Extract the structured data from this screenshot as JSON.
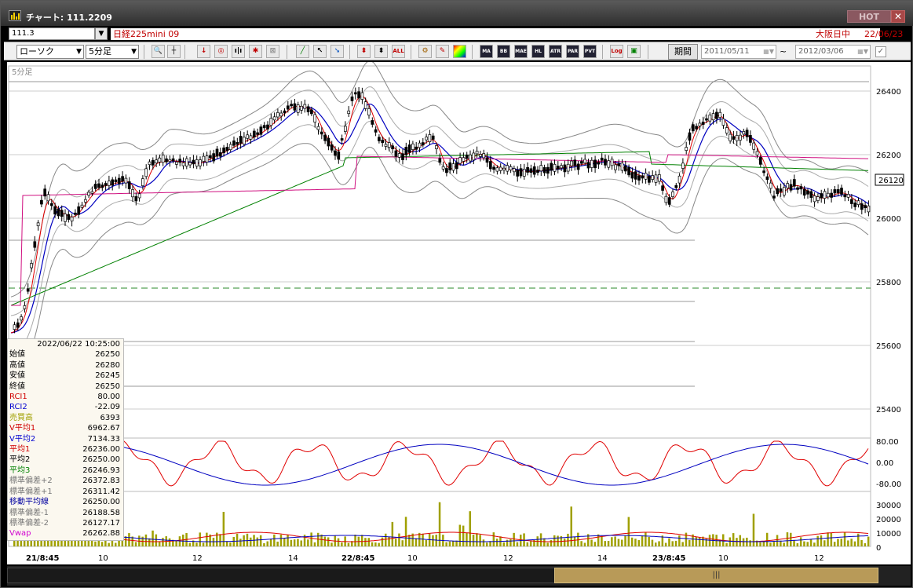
{
  "window": {
    "title": "チャート: 111.2209",
    "hot": "HOT",
    "close": "✕"
  },
  "symbol": {
    "code": "111.3",
    "name": "日経225mini 09",
    "session": "大阪日中",
    "date": "22/06/23"
  },
  "toolbar": {
    "chart_type": "ローソク",
    "interval": "5分足",
    "period_label": "期間",
    "date_from": "2011/05/11",
    "tilde": "~",
    "date_to": "2012/03/06",
    "buttons": [
      "MA",
      "BB",
      "MAE",
      "HL",
      "ATR",
      "PAR",
      "PVT",
      "Log"
    ]
  },
  "chart": {
    "interval_label": "5分足",
    "current_price": "26120",
    "y_ticks": [
      "26400",
      "26200",
      "26000",
      "25800",
      "25600",
      "25400"
    ],
    "osc_ticks": [
      "80.00",
      "0.00",
      "-80.00"
    ],
    "vol_ticks": [
      "30000",
      "20000",
      "10000",
      "0"
    ],
    "x_ticks": [
      "21/8:45",
      "10",
      "12",
      "14",
      "22/8:45",
      "10",
      "12",
      "14",
      "23/8:45",
      "10",
      "12"
    ]
  },
  "info": {
    "datetime": "2022/06/22  10:25:00",
    "rows": [
      {
        "label": "始値",
        "value": "26250",
        "color": "#000000"
      },
      {
        "label": "高値",
        "value": "26280",
        "color": "#000000"
      },
      {
        "label": "安値",
        "value": "26245",
        "color": "#000000"
      },
      {
        "label": "終値",
        "value": "26250",
        "color": "#000000"
      },
      {
        "label": "RCI1",
        "value": "80.00",
        "color": "#d00000"
      },
      {
        "label": "RCI2",
        "value": "-22.09",
        "color": "#0000d0"
      },
      {
        "label": "売買高",
        "value": "6393",
        "color": "#a0a000"
      },
      {
        "label": "V平均1",
        "value": "6962.67",
        "color": "#d00000"
      },
      {
        "label": "V平均2",
        "value": "7134.33",
        "color": "#0000d0"
      },
      {
        "label": "平均1",
        "value": "26236.00",
        "color": "#d00000"
      },
      {
        "label": "平均2",
        "value": "26250.00",
        "color": "#000000"
      },
      {
        "label": "平均3",
        "value": "26246.93",
        "color": "#008000"
      },
      {
        "label": "標準偏差+2",
        "value": "26372.83",
        "color": "#777777"
      },
      {
        "label": "標準偏差+1",
        "value": "26311.42",
        "color": "#777777"
      },
      {
        "label": "移動平均線",
        "value": "26250.00",
        "color": "#0000a0"
      },
      {
        "label": "標準偏差-1",
        "value": "26188.58",
        "color": "#777777"
      },
      {
        "label": "標準偏差-2",
        "value": "26127.17",
        "color": "#777777"
      },
      {
        "label": "Vwap",
        "value": "26262.88",
        "color": "#d000d0"
      }
    ]
  },
  "colors": {
    "ma_short": "#e00000",
    "ma_mid": "#0000c0",
    "ma_long": "#008000",
    "vwap": "#d01080",
    "volume": "#a0a000"
  }
}
